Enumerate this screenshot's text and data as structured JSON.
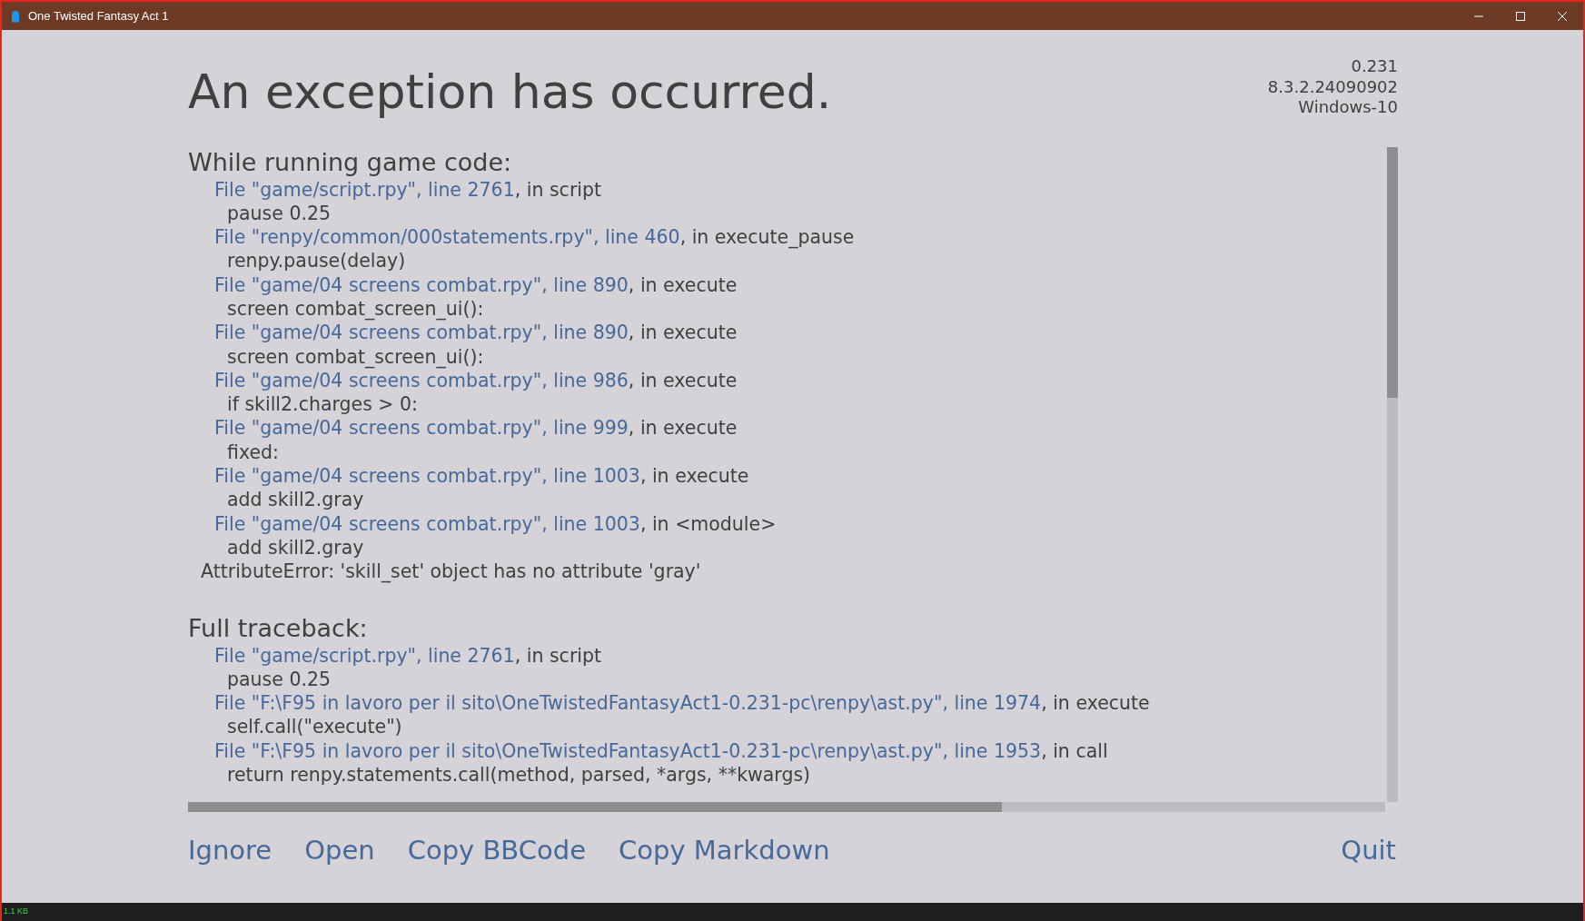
{
  "window": {
    "title": "One Twisted Fantasy Act 1"
  },
  "heading": "An exception has occurred.",
  "version_info": [
    "0.231",
    "8.3.2.24090902",
    "Windows-10"
  ],
  "sections": [
    {
      "title": "While running game code:",
      "lines": [
        {
          "kind": "file",
          "link": "File \"game/script.rpy\", line 2761",
          "rest": ", in script"
        },
        {
          "kind": "code",
          "text": "pause 0.25"
        },
        {
          "kind": "file",
          "link": "File \"renpy/common/000statements.rpy\", line 460",
          "rest": ", in execute_pause"
        },
        {
          "kind": "code",
          "text": "renpy.pause(delay)"
        },
        {
          "kind": "file",
          "link": "File \"game/04 screens combat.rpy\", line 890",
          "rest": ", in execute"
        },
        {
          "kind": "code",
          "text": "screen combat_screen_ui():"
        },
        {
          "kind": "file",
          "link": "File \"game/04 screens combat.rpy\", line 890",
          "rest": ", in execute"
        },
        {
          "kind": "code",
          "text": "screen combat_screen_ui():"
        },
        {
          "kind": "file",
          "link": "File \"game/04 screens combat.rpy\", line 986",
          "rest": ", in execute"
        },
        {
          "kind": "code",
          "text": "if skill2.charges > 0:"
        },
        {
          "kind": "file",
          "link": "File \"game/04 screens combat.rpy\", line 999",
          "rest": ", in execute"
        },
        {
          "kind": "code",
          "text": "fixed:"
        },
        {
          "kind": "file",
          "link": "File \"game/04 screens combat.rpy\", line 1003",
          "rest": ", in execute"
        },
        {
          "kind": "code",
          "text": "add skill2.gray"
        },
        {
          "kind": "file",
          "link": "File \"game/04 screens combat.rpy\", line 1003",
          "rest": ", in <module>"
        },
        {
          "kind": "code",
          "text": "add skill2.gray"
        },
        {
          "kind": "error",
          "text": "AttributeError: 'skill_set' object has no attribute 'gray'"
        }
      ]
    },
    {
      "title": "Full traceback:",
      "lines": [
        {
          "kind": "file",
          "link": "File \"game/script.rpy\", line 2761",
          "rest": ", in script"
        },
        {
          "kind": "code",
          "text": "pause 0.25"
        },
        {
          "kind": "file",
          "link": "File \"F:\\F95 in lavoro per il sito\\OneTwistedFantasyAct1-0.231-pc\\renpy\\ast.py\", line 1974",
          "rest": ", in execute"
        },
        {
          "kind": "code",
          "text": "self.call(\"execute\")"
        },
        {
          "kind": "file",
          "link": "File \"F:\\F95 in lavoro per il sito\\OneTwistedFantasyAct1-0.231-pc\\renpy\\ast.py\", line 1953",
          "rest": ", in call"
        },
        {
          "kind": "code",
          "text": "return renpy.statements.call(method, parsed, *args, **kwargs)"
        }
      ]
    }
  ],
  "actions": [
    "Ignore",
    "Open",
    "Copy BBCode",
    "Copy Markdown"
  ],
  "quit": "Quit",
  "taskbar": {
    "net_speed": "1.1 KB"
  }
}
